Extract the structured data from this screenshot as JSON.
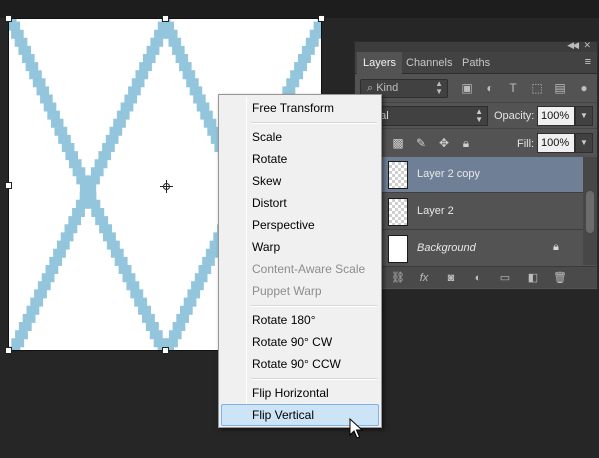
{
  "canvas": {
    "pattern_color": "#93c5dc",
    "background_color": "#ffffff"
  },
  "layers_panel": {
    "tabs": [
      {
        "label": "Layers",
        "active": true
      },
      {
        "label": "Channels",
        "active": false
      },
      {
        "label": "Paths",
        "active": false
      }
    ],
    "filter": {
      "kind_label": "Kind"
    },
    "blend_mode_visible_text": "mal",
    "opacity_label": "Opacity:",
    "opacity_value": "100%",
    "fill_label": "Fill:",
    "fill_value": "100%",
    "layers": [
      {
        "name": "Layer 2 copy",
        "selected": true,
        "thumb": "transparent"
      },
      {
        "name": "Layer 2",
        "selected": false,
        "thumb": "transparent"
      },
      {
        "name": "Background",
        "selected": false,
        "thumb": "white",
        "locked": true
      }
    ],
    "footer_icons": [
      "link-icon",
      "fx-icon",
      "mask-icon",
      "adjustment-icon",
      "folder-icon",
      "new-layer-icon",
      "trash-icon"
    ]
  },
  "context_menu": {
    "groups": [
      [
        {
          "label": "Free Transform",
          "disabled": false
        }
      ],
      [
        {
          "label": "Scale",
          "disabled": false
        },
        {
          "label": "Rotate",
          "disabled": false
        },
        {
          "label": "Skew",
          "disabled": false
        },
        {
          "label": "Distort",
          "disabled": false
        },
        {
          "label": "Perspective",
          "disabled": false
        },
        {
          "label": "Warp",
          "disabled": false
        },
        {
          "label": "Content-Aware Scale",
          "disabled": true
        },
        {
          "label": "Puppet Warp",
          "disabled": true
        }
      ],
      [
        {
          "label": "Rotate 180°",
          "disabled": false
        },
        {
          "label": "Rotate 90° CW",
          "disabled": false
        },
        {
          "label": "Rotate 90° CCW",
          "disabled": false
        }
      ],
      [
        {
          "label": "Flip Horizontal",
          "disabled": false
        },
        {
          "label": "Flip Vertical",
          "disabled": false,
          "hovered": true
        }
      ]
    ]
  },
  "colors": {
    "menu_hover_bg": "#cde4f7",
    "menu_hover_border": "#7eb4ea",
    "layer_selected_bg": "#6f7f96",
    "panel_bg": "#535353"
  }
}
